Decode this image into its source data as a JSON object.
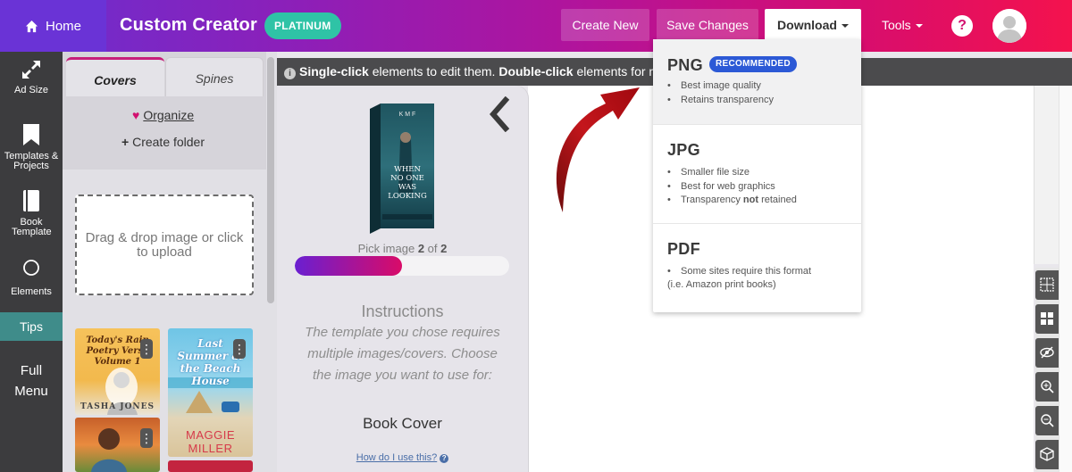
{
  "topbar": {
    "home_label": "Home",
    "app_title": "Custom Creator",
    "plan_badge": "PLATINUM",
    "create_new_label": "Create New",
    "save_changes_label": "Save Changes",
    "download_label": "Download",
    "tools_label": "Tools",
    "help_symbol": "?",
    "colors": {
      "gradient_start": "#6a2fd0",
      "gradient_end": "#f4124d",
      "badge": "#2fc3a6"
    }
  },
  "leftnav": {
    "items": [
      {
        "label": "Ad Size",
        "icon": "expand-arrows-icon"
      },
      {
        "label": "Templates & Projects",
        "icon": "bookmark-icon"
      },
      {
        "label": "Book Template",
        "icon": "book-icon"
      },
      {
        "label": "Elements",
        "icon": "circle-icon"
      }
    ],
    "tips_label": "Tips",
    "full_menu_label_1": "Full",
    "full_menu_label_2": "Menu"
  },
  "panel": {
    "tabs": [
      {
        "label": "Covers",
        "active": true
      },
      {
        "label": "Spines",
        "active": false
      }
    ],
    "organize_label": "Organize",
    "create_folder_label": "Create folder",
    "dropzone_text": "Drag & drop image or click to upload",
    "thumbnails": [
      {
        "title": "Today's Rain Poetry Verse Volume 1",
        "author": "TASHA JONES"
      },
      {
        "title": "Last Summer at the Beach House",
        "author": "MAGGIE MILLER"
      }
    ]
  },
  "infobar": {
    "bold_1": "Single-click",
    "text_1": " elements to edit them. ",
    "bold_2": "Double-click",
    "text_2": " elements for more"
  },
  "pick_card": {
    "pick_prefix": "Pick image",
    "current": "2",
    "of_word": "of",
    "total": "2",
    "progress_fraction": 0.5,
    "book_title": "WHEN NO ONE WAS LOOKING",
    "book_author": "K M F",
    "instructions_title": "Instructions",
    "instructions_body": "The template you chose requires multiple images/covers. Choose the image you want to use for:",
    "target": "Book Cover",
    "help_link": "How do I use this?"
  },
  "download_menu": {
    "options": [
      {
        "format": "PNG",
        "badge": "RECOMMENDED",
        "bullets": [
          "Best image quality",
          "Retains transparency"
        ]
      },
      {
        "format": "JPG",
        "bullets": [
          "Smaller file size",
          "Best for web graphics"
        ],
        "bullet_3_pre": "Transparency ",
        "bullet_3_bold": "not",
        "bullet_3_post": " retained"
      },
      {
        "format": "PDF",
        "bullets": [
          "Some sites require this format"
        ],
        "note": "(i.e. Amazon print books)"
      }
    ]
  },
  "side_tools": [
    "grid-icon",
    "layout-icon",
    "eye-slash-icon",
    "zoom-in-icon",
    "zoom-out-icon",
    "box-icon"
  ]
}
